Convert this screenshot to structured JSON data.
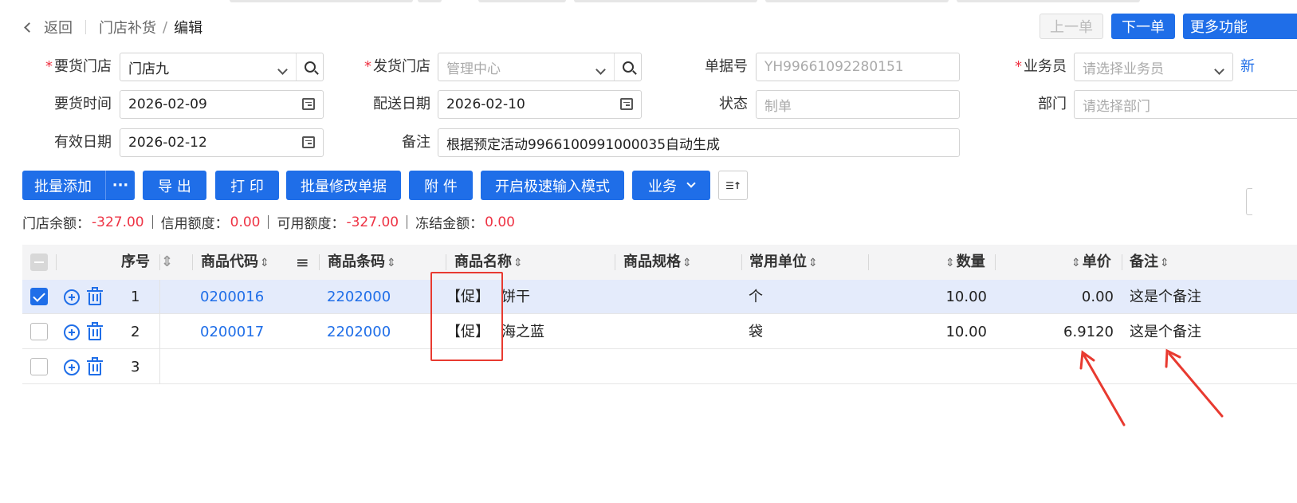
{
  "header": {
    "back_label": "返回",
    "breadcrumb_parent": "门店补货",
    "breadcrumb_sep": "/",
    "breadcrumb_current": "编辑",
    "prev_label": "上一单",
    "next_label": "下一单",
    "more_label": "更多功能"
  },
  "form": {
    "req_mark": "*",
    "request_store_label": "要货门店",
    "request_store_value": "门店九",
    "ship_store_label": "发货门店",
    "ship_store_placeholder": "管理中心",
    "doc_no_label": "单据号",
    "doc_no_value": "YH99661092280151",
    "salesman_label": "业务员",
    "salesman_placeholder": "请选择业务员",
    "new_link": "新",
    "request_time_label": "要货时间",
    "request_time_value": "2026-02-09",
    "delivery_date_label": "配送日期",
    "delivery_date_value": "2026-02-10",
    "status_label": "状态",
    "status_placeholder": "制单",
    "dept_label": "部门",
    "dept_placeholder": "请选择部门",
    "valid_date_label": "有效日期",
    "valid_date_value": "2026-02-12",
    "remark_label": "备注",
    "remark_value": "根据预定活动9966100991000035自动生成"
  },
  "toolbar": {
    "batch_add": "批量添加",
    "more_dots": "···",
    "export": "导 出",
    "print": "打 印",
    "batch_edit": "批量修改单据",
    "attach": "附 件",
    "fast_input": "开启极速输入模式",
    "business": "业务",
    "column_setting_glyph": "☰↑"
  },
  "balance": {
    "store_balance_label": "门店余额：",
    "store_balance_value": "-327.00",
    "credit_label": "信用额度：",
    "credit_value": "0.00",
    "available_label": "可用额度：",
    "available_value": "-327.00",
    "frozen_label": "冻结金额：",
    "frozen_value": "0.00"
  },
  "table": {
    "sort_icon": "⇕",
    "menu_icon": "≡",
    "columns": {
      "seq": "序号",
      "code": "商品代码",
      "barcode": "商品条码",
      "name": "商品名称",
      "spec": "商品规格",
      "unit": "常用单位",
      "qty": "数量",
      "price": "单价",
      "remark": "备注"
    },
    "rows": [
      {
        "seq": "1",
        "code": "0200016",
        "barcode": "2202000",
        "promo": "【促】",
        "name": "饼干",
        "unit": "个",
        "qty": "10.00",
        "price": "0.00",
        "remark": "这是个备注",
        "checked": true
      },
      {
        "seq": "2",
        "code": "0200017",
        "barcode": "2202000",
        "promo": "【促】",
        "name": "海之蓝",
        "unit": "袋",
        "qty": "10.00",
        "price": "6.9120",
        "remark": "这是个备注",
        "checked": false
      },
      {
        "seq": "3",
        "code": "",
        "barcode": "",
        "promo": "",
        "name": "",
        "unit": "",
        "qty": "",
        "price": "",
        "remark": "",
        "checked": false
      }
    ]
  },
  "colors": {
    "primary": "#1f6ee8",
    "negative": "#e34433",
    "annotation": "#e83a30",
    "selected_row": "#e4ebfb"
  }
}
